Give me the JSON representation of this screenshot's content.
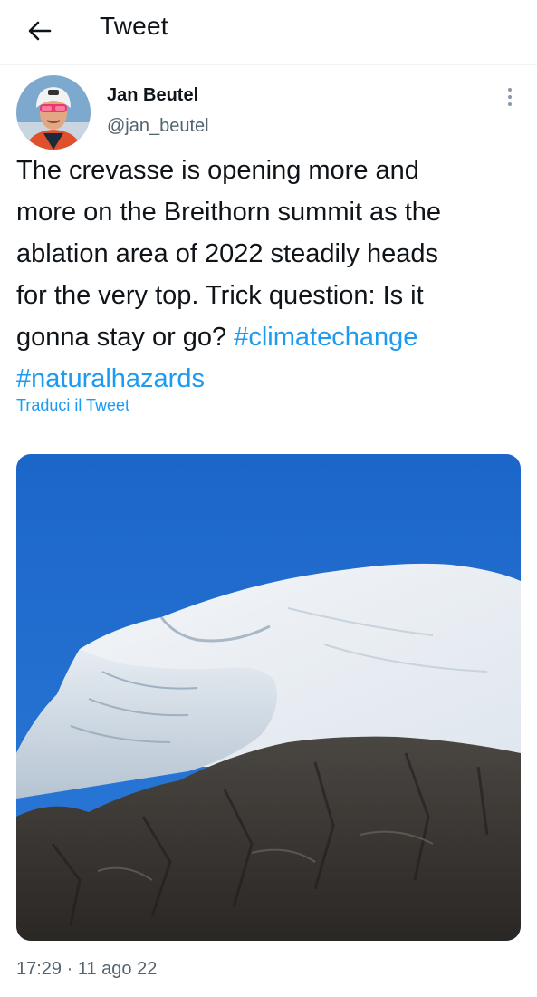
{
  "header": {
    "title": "Tweet",
    "back_icon": "arrow-left-icon"
  },
  "author": {
    "name": "Jan Beutel",
    "handle": "@jan_beutel",
    "more_icon": "vertical-dots-icon"
  },
  "tweet": {
    "lines": [
      "The crevasse is opening more and",
      "more on the Breithorn summit as the",
      "ablation area of 2022 steadily heads",
      "for the very top. Trick question: Is it"
    ],
    "line5_text": "gonna stay or go? ",
    "hashtags": [
      "#climatechange",
      "#naturalhazards"
    ],
    "translate_label": "Traduci il Tweet",
    "timestamp": "17:29 · 11 ago 22"
  },
  "colors": {
    "accent": "#1d9bf0",
    "secondary_text": "#536471",
    "sky": "#1f6fd0"
  }
}
